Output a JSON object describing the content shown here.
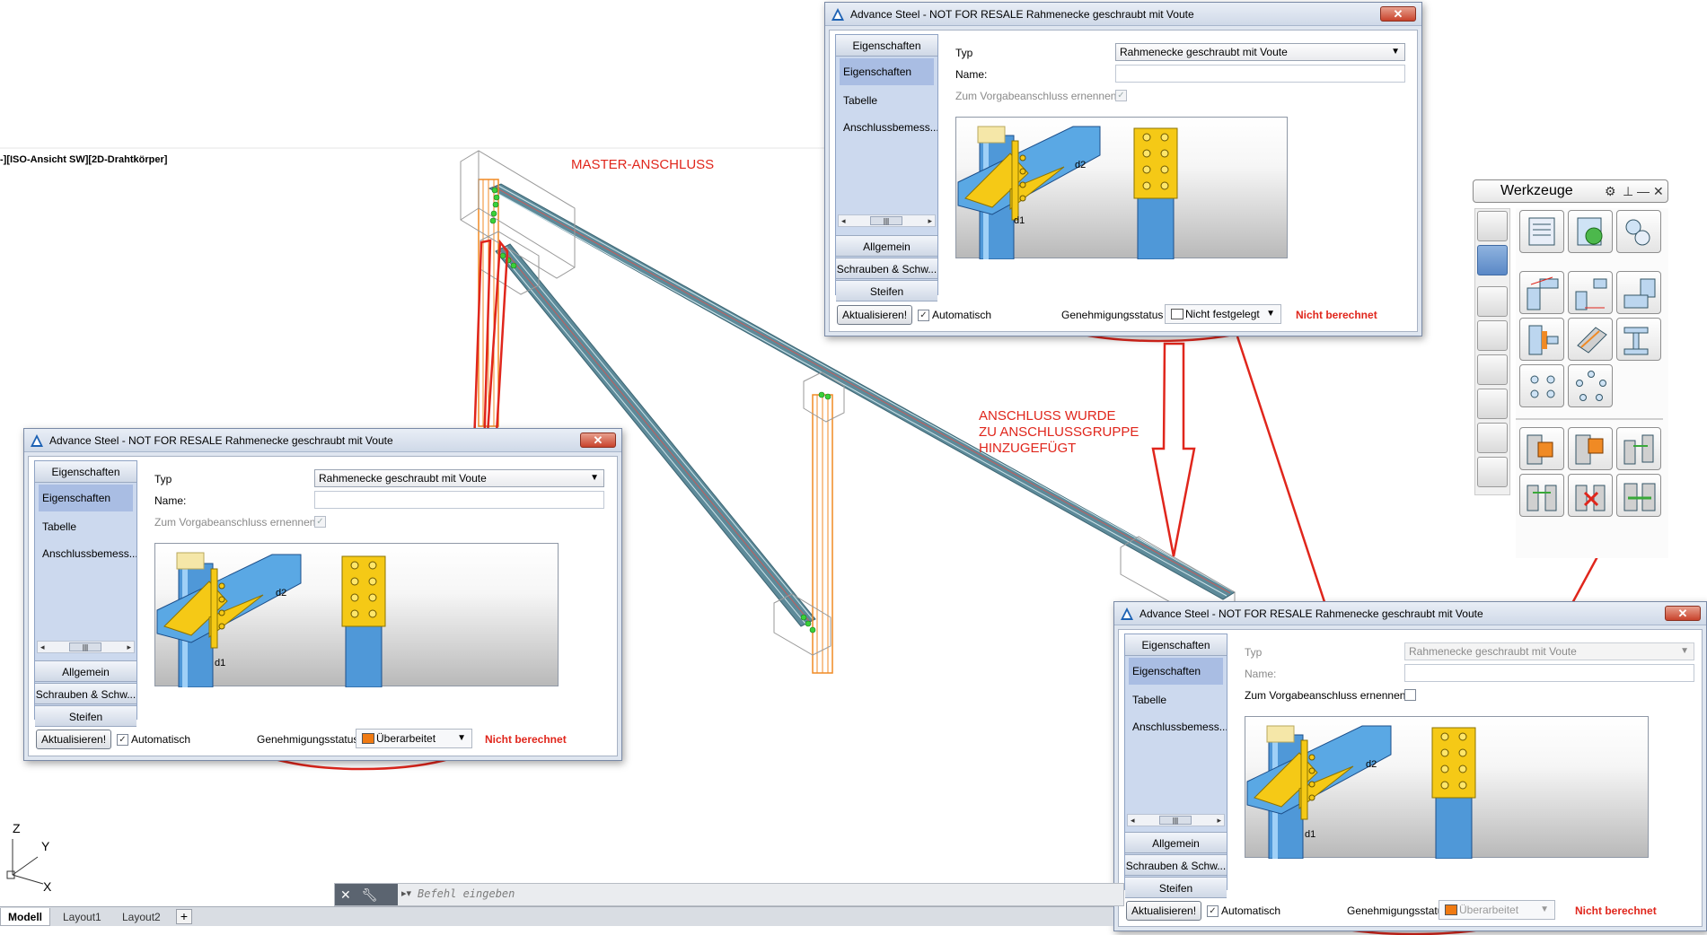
{
  "viewport": {
    "label": "-][ISO-Ansicht SW][2D-Drahtkörper]",
    "annotations": {
      "master": "MASTER-ANSCHLUSS",
      "group_line1": "ANSCHLUSS WURDE",
      "group_line2": "ZU ANSCHLUSSGRUPPE",
      "group_line3": "HINZUGEFÜGT"
    },
    "ucs": {
      "z": "Z",
      "y": "Y",
      "x": "X"
    },
    "colors": {
      "annotation": "#e0261c",
      "beam": "#4e8090",
      "column": "#f08a24"
    }
  },
  "dialogs": [
    {
      "title": "Advance Steel - NOT FOR RESALE   Rahmenecke geschraubt mit Voute",
      "close": "✕",
      "side_head": "Eigenschaften",
      "side_items": [
        "Eigenschaften",
        "Tabelle",
        "Anschlussbemess..."
      ],
      "side_footer": [
        "Allgemein",
        "Schrauben & Schw...",
        "Steifen"
      ],
      "typ_label": "Typ",
      "typ_value": "Rahmenecke geschraubt mit Voute",
      "name_label": "Name:",
      "vorgabe_label": "Zum Vorgabeanschluss ernennen",
      "vorgabe_checked": "✓",
      "d1": "d1",
      "d2": "d2",
      "update_button": "Aktualisieren!",
      "auto_label": "Automatisch",
      "auto_checked": "✓",
      "status_label": "Genehmigungsstatus",
      "status_value": "Nicht festgelegt",
      "status_color": "#ffffff",
      "calc_state": "Nicht berechnet"
    },
    {
      "title": "Advance Steel - NOT FOR RESALE   Rahmenecke geschraubt mit Voute",
      "close": "✕",
      "side_head": "Eigenschaften",
      "side_items": [
        "Eigenschaften",
        "Tabelle",
        "Anschlussbemess..."
      ],
      "side_footer": [
        "Allgemein",
        "Schrauben & Schw...",
        "Steifen"
      ],
      "typ_label": "Typ",
      "typ_value": "Rahmenecke geschraubt mit Voute",
      "name_label": "Name:",
      "vorgabe_label": "Zum Vorgabeanschluss ernennen",
      "vorgabe_checked": "✓",
      "d1": "d1",
      "d2": "d2",
      "update_button": "Aktualisieren!",
      "auto_label": "Automatisch",
      "auto_checked": "✓",
      "status_label": "Genehmigungsstatus",
      "status_value": "Überarbeitet",
      "status_color": "#f07a12",
      "calc_state": "Nicht berechnet"
    },
    {
      "title": "Advance Steel - NOT FOR RESALE   Rahmenecke geschraubt mit Voute",
      "close": "✕",
      "side_head": "Eigenschaften",
      "side_items": [
        "Eigenschaften",
        "Tabelle",
        "Anschlussbemess..."
      ],
      "side_footer": [
        "Allgemein",
        "Schrauben & Schw...",
        "Steifen"
      ],
      "typ_label": "Typ",
      "typ_value": "Rahmenecke geschraubt mit Voute",
      "name_label": "Name:",
      "vorgabe_label": "Zum Vorgabeanschluss ernennen",
      "vorgabe_checked": "",
      "d1": "d1",
      "d2": "d2",
      "update_button": "Aktualisieren!",
      "auto_label": "Automatisch",
      "auto_checked": "✓",
      "status_label": "Genehmigungsstatus",
      "status_value": "Überarbeitet",
      "status_color": "#f07a12",
      "calc_state": "Nicht berechnet"
    }
  ],
  "toolbox": {
    "title": "Werkzeuge",
    "controls": [
      "gear-icon",
      "pin-icon",
      "minimize-icon",
      "close-icon"
    ]
  },
  "command_line": {
    "placeholder": "Befehl eingeben",
    "icons": [
      "close-icon",
      "wrench-icon",
      "prompt-icon"
    ]
  },
  "layout_tabs": {
    "tabs": [
      "Modell",
      "Layout1",
      "Layout2"
    ],
    "active": "Modell",
    "add": "+"
  }
}
